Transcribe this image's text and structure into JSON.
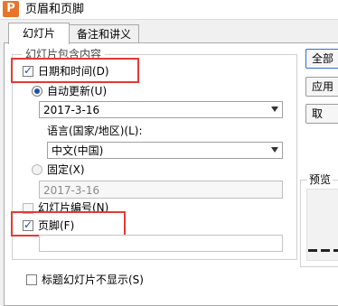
{
  "window": {
    "title": "页眉和页脚",
    "app_icon_letter": "P"
  },
  "tabs": [
    {
      "label": "幻灯片",
      "active": true
    },
    {
      "label": "备注和讲义",
      "active": false
    }
  ],
  "group": {
    "label": "幻灯片包含内容",
    "date_time": {
      "label": "日期和时间(D)",
      "checked": true
    },
    "auto_update": {
      "label": "自动更新(U)",
      "selected": true,
      "value": "2017-3-16"
    },
    "language": {
      "label": "语言(国家/地区)(L):",
      "value": "中文(中国)"
    },
    "fixed": {
      "label": "固定(X)",
      "selected": false,
      "value": "2017-3-16"
    },
    "slide_number": {
      "label": "幻灯片编号(N)",
      "checked": false
    },
    "footer": {
      "label": "页脚(F)",
      "checked": true,
      "value": ""
    }
  },
  "hide_on_title": {
    "label": "标题幻灯片不显示(S)",
    "checked": false
  },
  "buttons": {
    "apply_all": "全部",
    "apply": "应用",
    "cancel": "取"
  },
  "preview": {
    "label": "预览"
  },
  "colors": {
    "highlight": "#e53935",
    "accent": "#1c4fae",
    "app_icon": "#e8742a"
  }
}
